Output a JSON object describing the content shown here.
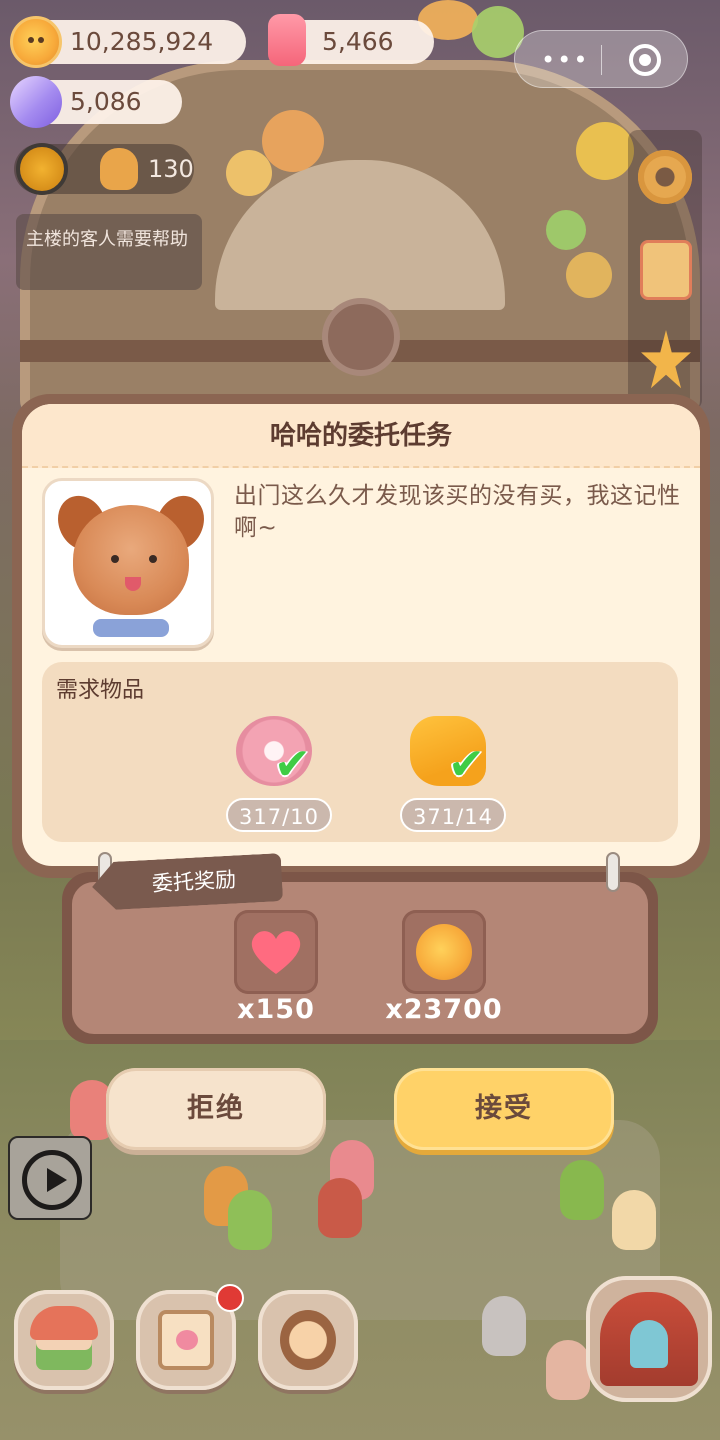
{
  "hud": {
    "cookies": "10,285,924",
    "candles": "5,466",
    "gems": "5,086",
    "guest_count": "130",
    "notice": "主楼的客人需要帮助"
  },
  "dialog": {
    "title": "哈哈的委托任务",
    "quest_text": "出门这么久才发现该买的没有买，我这记性啊~",
    "requirements_label": "需求物品",
    "items": [
      {
        "icon": "donut-icon",
        "count": "317/10",
        "fulfilled": true
      },
      {
        "icon": "bread-icon",
        "count": "371/14",
        "fulfilled": true
      }
    ]
  },
  "rewards": {
    "label": "委托奖励",
    "items": [
      {
        "icon": "heart-icon",
        "qty": "x150"
      },
      {
        "icon": "cookie-icon",
        "qty": "x23700"
      }
    ]
  },
  "actions": {
    "reject": "拒绝",
    "accept": "接受"
  },
  "icons": {
    "check": "✔",
    "more_dots": "•••"
  },
  "colors": {
    "accept_button": "#ffd268",
    "reject_button": "#f6e3cc",
    "check_green": "#3fcc45",
    "panel_cream": "#fff3df",
    "board_brown": "#b48676"
  }
}
